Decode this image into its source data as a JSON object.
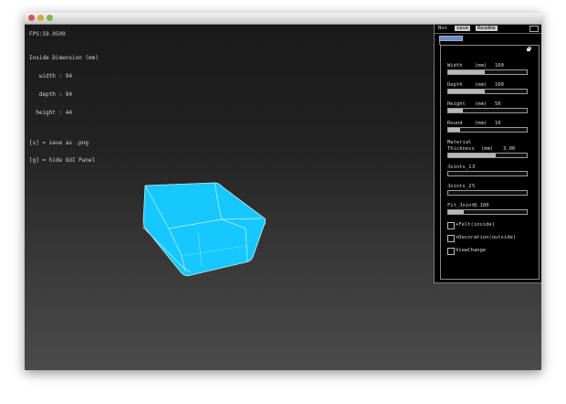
{
  "hud": {
    "fps": "FPS:59.0509",
    "lines": [
      "Inside Dimension (mm)",
      "   width : 94",
      "   depth : 94",
      "  height : 44",
      "",
      "[s] = save as .png",
      "[g] = hide GUI Panel"
    ]
  },
  "panel": {
    "tabs": [
      "Box",
      "save",
      "Readme"
    ],
    "index": "1",
    "sliders": [
      {
        "label": "Width",
        "unit": "(mm)",
        "value": "100",
        "fill": 0.47
      },
      {
        "label": "Depth",
        "unit": "(mm)",
        "value": "100",
        "fill": 0.47
      },
      {
        "label": "Height",
        "unit": "(mm)",
        "value": "50",
        "fill": 0.19
      },
      {
        "label": "Round",
        "unit": "(mm)",
        "value": "10",
        "fill": 0.15
      }
    ],
    "material": {
      "line1": "Material",
      "line2": "Thickness",
      "unit": "(mm)",
      "value": "3.00",
      "fill": 0.6
    },
    "joints": [
      {
        "label": "Joints_1",
        "value": "3",
        "fill": 0
      },
      {
        "label": "Joints_2",
        "value": "5",
        "fill": 0
      },
      {
        "label": "Fit_Joint",
        "value": "0.100",
        "fill": 0.2
      }
    ],
    "toggles": [
      "+Felt(inside)",
      "+Decoration(outside)",
      "ViewChange"
    ]
  },
  "colors": {
    "box_fill": "#17c8ff",
    "box_edge": "#bff1ff",
    "panel_bg": "#000000",
    "slider_fill": "#b8b8b8",
    "accent_tab": "#6b8bd6"
  }
}
